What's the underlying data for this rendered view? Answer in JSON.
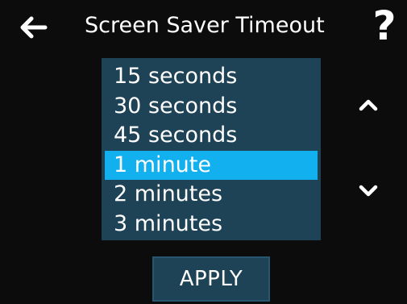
{
  "header": {
    "title": "Screen Saver Timeout",
    "back_icon": "arrow-left-icon",
    "help_label": "?"
  },
  "options": {
    "items": [
      {
        "label": "15 seconds"
      },
      {
        "label": "30 seconds"
      },
      {
        "label": "45 seconds"
      },
      {
        "label": "1 minute"
      },
      {
        "label": "2 minutes"
      },
      {
        "label": "3 minutes"
      }
    ],
    "selected": "1 minute"
  },
  "scroll": {
    "up_icon": "chevron-up-icon",
    "down_icon": "chevron-down-icon"
  },
  "actions": {
    "apply_label": "APPLY"
  },
  "colors": {
    "background": "#0c0c0c",
    "panel": "#1e4256",
    "selected": "#12b0ee",
    "text": "#ffffff"
  }
}
